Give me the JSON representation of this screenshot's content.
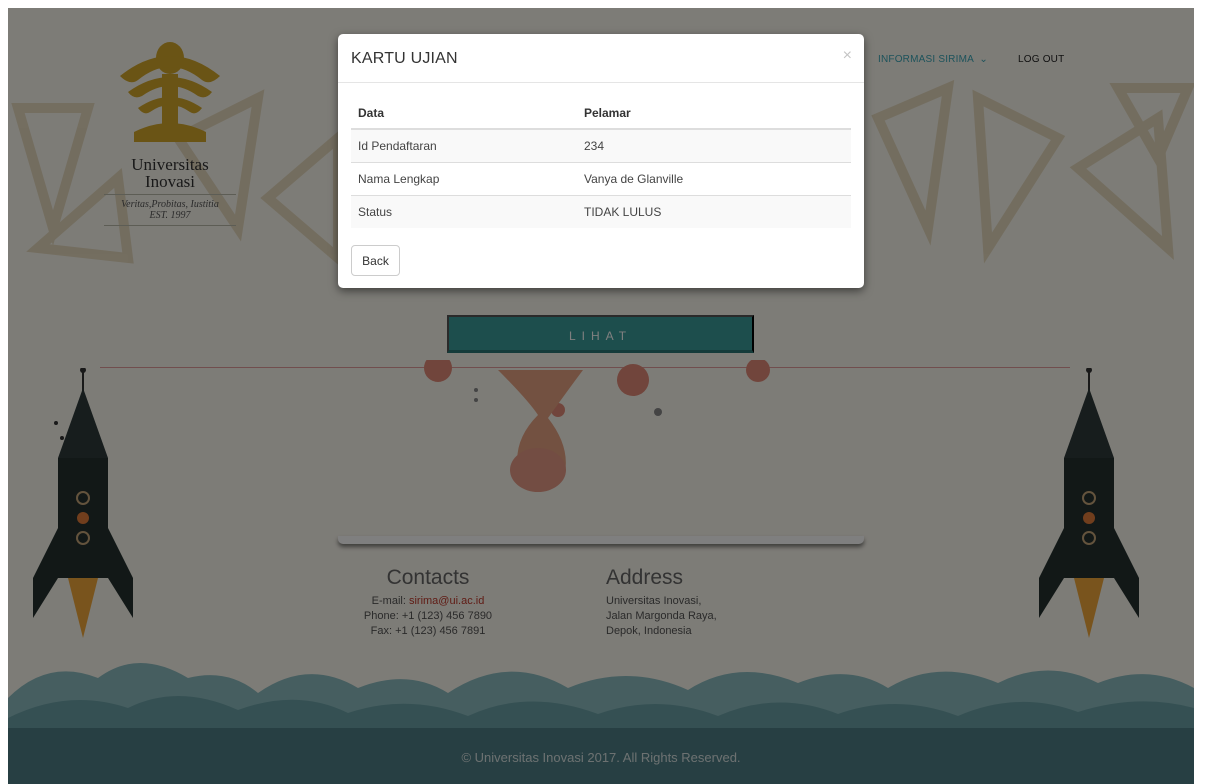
{
  "brand": {
    "name_line1": "Universitas",
    "name_line2": "Inovasi",
    "motto": "Veritas,Probitas, Iustitia",
    "est": "EST. 1997",
    "gold": "#d4a82a"
  },
  "nav": {
    "info_label": "INFORMASI SIRIMA",
    "info_icon": "chevron-down-icon",
    "logout_label": "LOG OUT"
  },
  "page": {
    "lihat_label": "LIHAT"
  },
  "modal": {
    "title": "KARTU UJIAN",
    "close_glyph": "×",
    "headers": [
      "Data",
      "Pelamar"
    ],
    "rows": [
      {
        "label": "Id Pendaftaran",
        "value": "234"
      },
      {
        "label": "Nama Lengkap",
        "value": "Vanya de Glanville"
      },
      {
        "label": "Status",
        "value": "TIDAK LULUS"
      }
    ],
    "back_label": "Back"
  },
  "footer": {
    "contacts_title": "Contacts",
    "email_label": "E-mail:",
    "email_value": "sirima@ui.ac.id",
    "phone": "Phone: +1 (123) 456 7890",
    "fax": "Fax: +1 (123) 456 7891",
    "address_title": "Address",
    "address_line1": "Universitas Inovasi,",
    "address_line2": "Jalan Margonda Raya,",
    "address_line3": "Depok, Indonesia",
    "copyright": "© Universitas Inovasi 2017. All Rights Reserved."
  },
  "colors": {
    "accent": "#3aa6b6",
    "button": "#3a9d9a",
    "footer_bg": "#4f7f86",
    "status_fail": "#444444"
  }
}
